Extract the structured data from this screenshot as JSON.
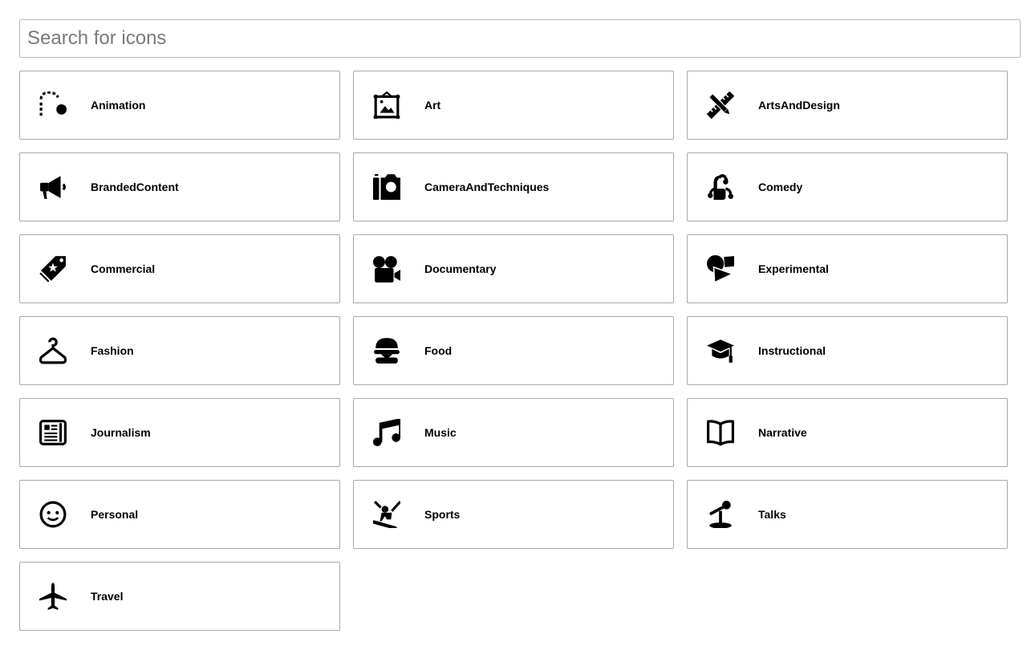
{
  "search": {
    "placeholder": "Search for icons"
  },
  "items": [
    {
      "label": "Animation",
      "icon": "animation-icon"
    },
    {
      "label": "Art",
      "icon": "art-icon"
    },
    {
      "label": "ArtsAndDesign",
      "icon": "arts-and-design-icon"
    },
    {
      "label": "BrandedContent",
      "icon": "branded-content-icon"
    },
    {
      "label": "CameraAndTechniques",
      "icon": "camera-and-techniques-icon"
    },
    {
      "label": "Comedy",
      "icon": "comedy-icon"
    },
    {
      "label": "Commercial",
      "icon": "commercial-icon"
    },
    {
      "label": "Documentary",
      "icon": "documentary-icon"
    },
    {
      "label": "Experimental",
      "icon": "experimental-icon"
    },
    {
      "label": "Fashion",
      "icon": "fashion-icon"
    },
    {
      "label": "Food",
      "icon": "food-icon"
    },
    {
      "label": "Instructional",
      "icon": "instructional-icon"
    },
    {
      "label": "Journalism",
      "icon": "journalism-icon"
    },
    {
      "label": "Music",
      "icon": "music-icon"
    },
    {
      "label": "Narrative",
      "icon": "narrative-icon"
    },
    {
      "label": "Personal",
      "icon": "personal-icon"
    },
    {
      "label": "Sports",
      "icon": "sports-icon"
    },
    {
      "label": "Talks",
      "icon": "talks-icon"
    },
    {
      "label": "Travel",
      "icon": "travel-icon"
    }
  ]
}
